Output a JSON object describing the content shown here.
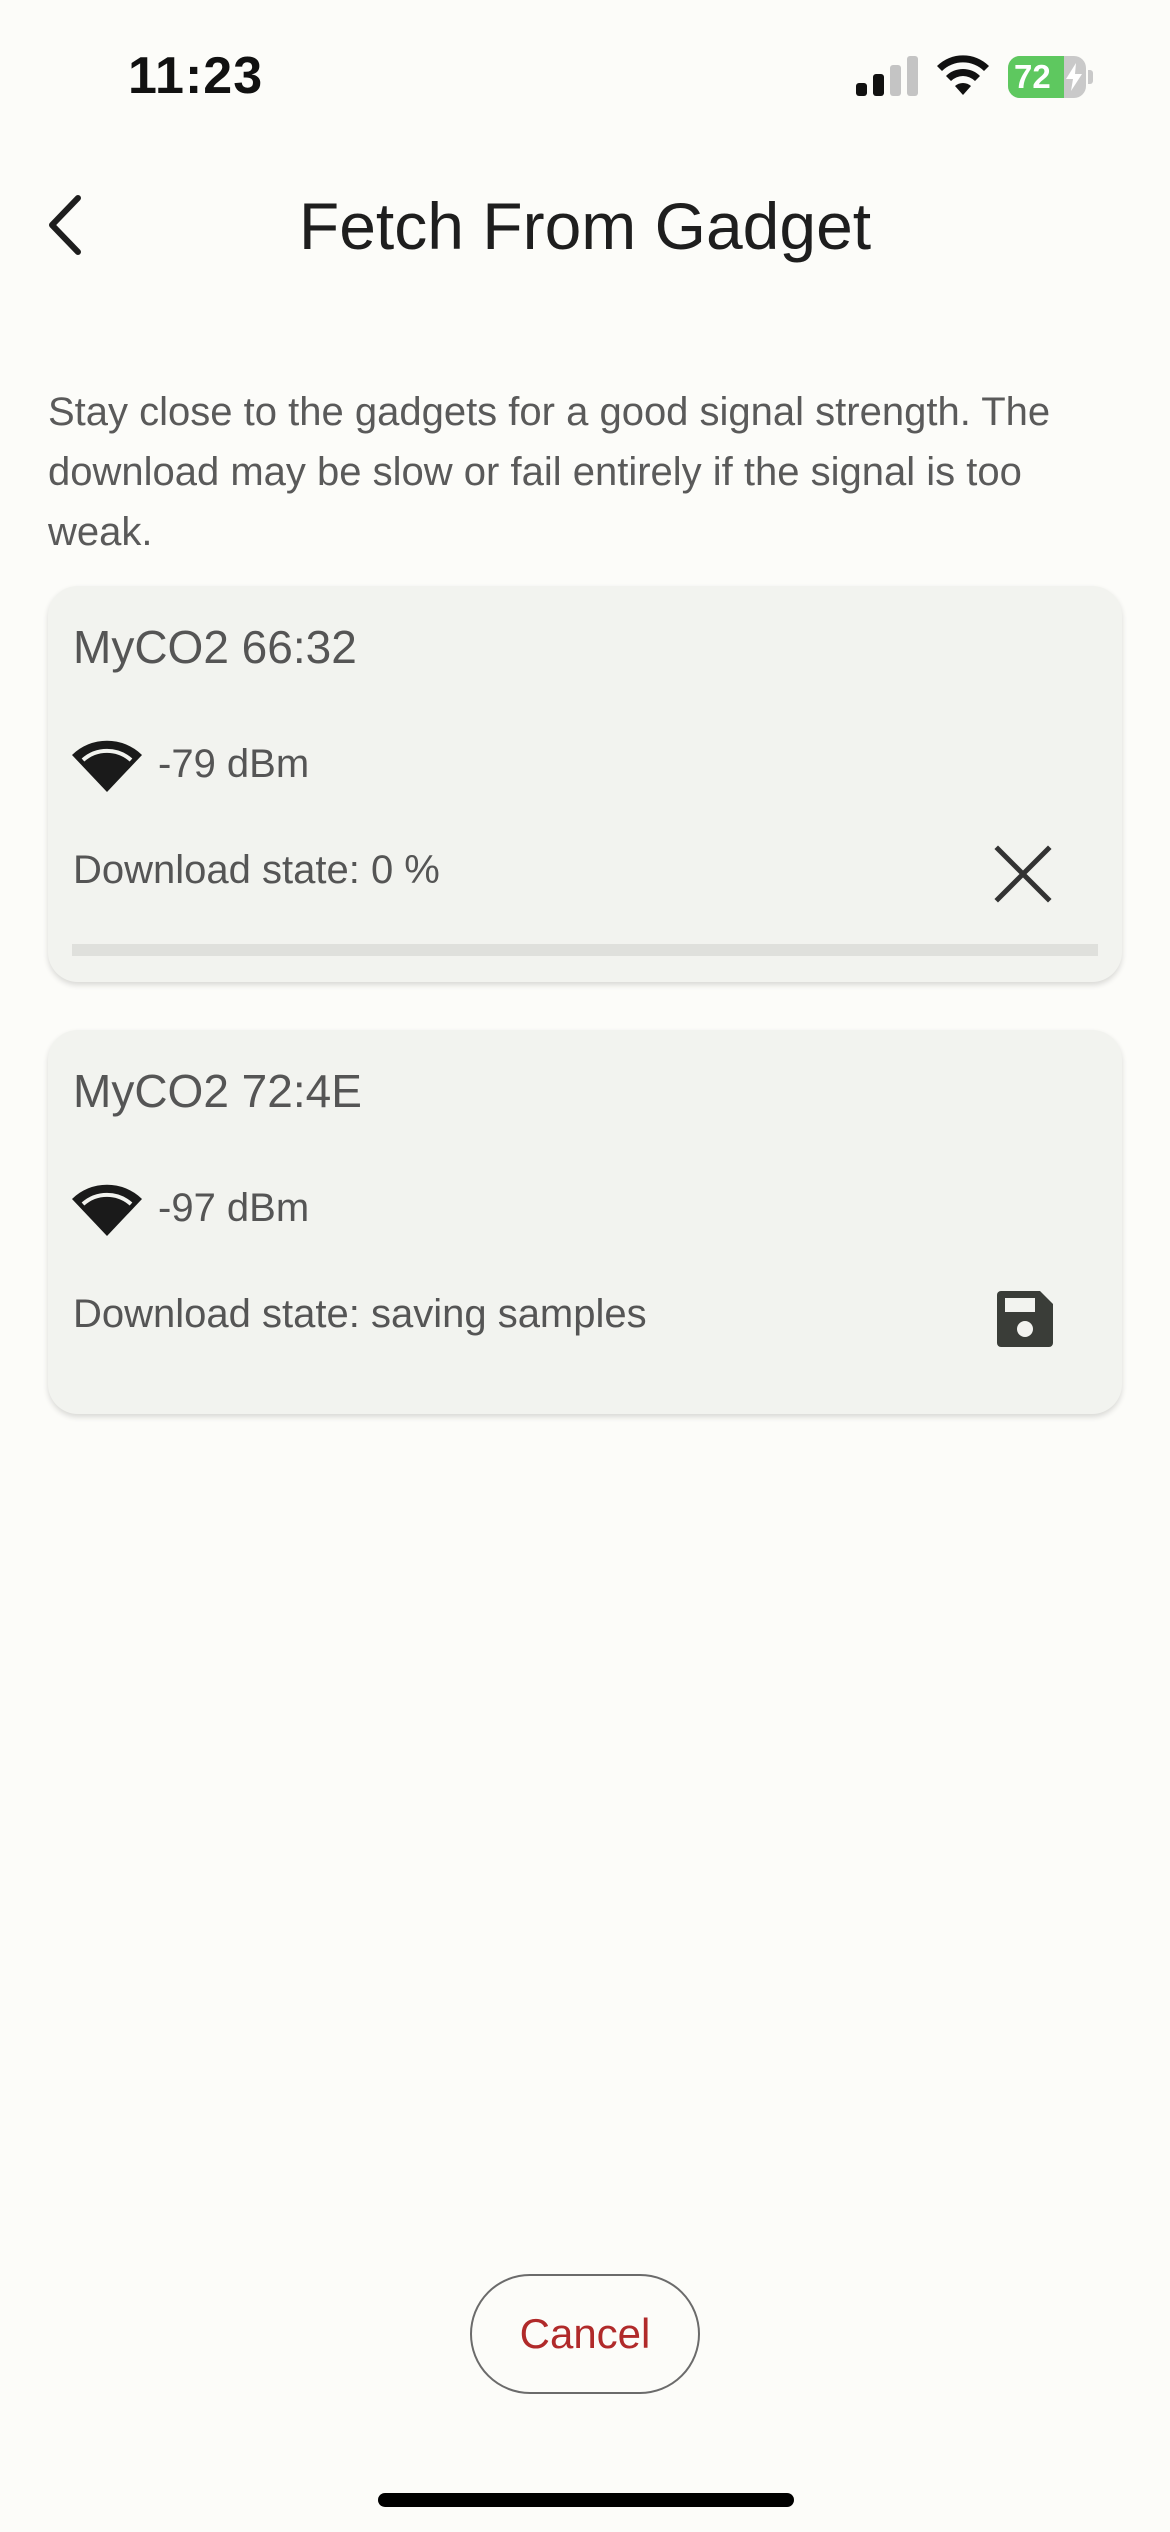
{
  "status_bar": {
    "time": "11:23",
    "battery_text": "72",
    "battery_level": 0.72,
    "battery_color": "#5ec85f",
    "signal_icon": "cellular-signal-icon",
    "wifi_icon": "wifi-icon",
    "charging_icon": "bolt-icon"
  },
  "header": {
    "title": "Fetch From Gadget",
    "back_icon": "chevron-left-icon"
  },
  "intro_text": "Stay close to the gadgets for a good signal strength. The download may be slow or fail entirely if the signal is too weak.",
  "gadgets": [
    {
      "name": "MyCO2 66:32",
      "rssi": "-79 dBm",
      "state": "Download state: 0 %",
      "progress": 0,
      "action_icon": "close-icon"
    },
    {
      "name": "MyCO2 72:4E",
      "rssi": "-97 dBm",
      "state": "Download state: saving samples",
      "action_icon": "save-icon"
    }
  ],
  "footer": {
    "cancel_label": "Cancel",
    "cancel_color": "#b02a2a"
  }
}
